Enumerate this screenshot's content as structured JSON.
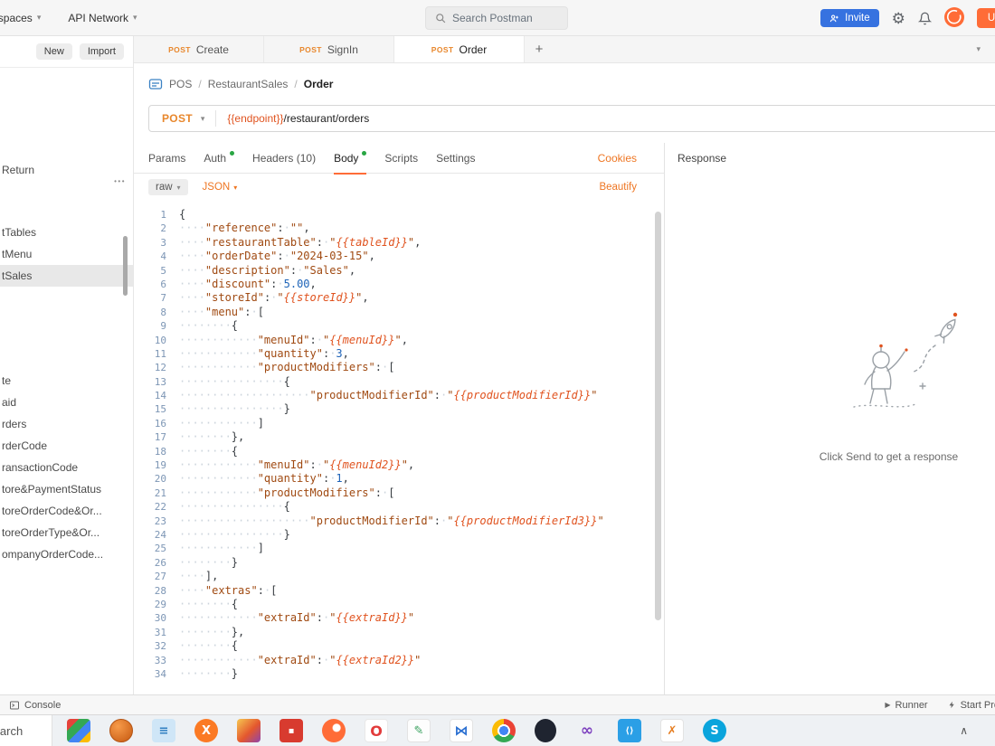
{
  "header": {
    "workspaces": "Workspaces",
    "api_network": "API Network",
    "search_placeholder": "Search Postman",
    "invite": "Invite",
    "upgrade": "Upgrade"
  },
  "icons": {
    "chevron_down": "▾",
    "chevron_up": "∧",
    "more_dots": "•••",
    "gear": "⚙",
    "plus": "+",
    "play": "▶"
  },
  "sidebar": {
    "new_button": "New",
    "import_button": "Import",
    "groups": [
      {
        "items": [
          {
            "label": "Return"
          }
        ]
      },
      {
        "items": [
          {
            "label": "tTables"
          },
          {
            "label": "tMenu"
          },
          {
            "label": "tSales",
            "selected": true
          }
        ]
      },
      {
        "items": [
          {
            "label": "te"
          },
          {
            "label": "aid"
          },
          {
            "label": "rders"
          },
          {
            "label": "rderCode"
          },
          {
            "label": "ransactionCode"
          },
          {
            "label": "tore&PaymentStatus"
          },
          {
            "label": "toreOrderCode&Or..."
          },
          {
            "label": "toreOrderType&Or..."
          },
          {
            "label": "ompanyOrderCode..."
          }
        ]
      }
    ]
  },
  "tabs": {
    "items": [
      {
        "method": "POST",
        "name": "Create"
      },
      {
        "method": "POST",
        "name": "SignIn"
      },
      {
        "method": "POST",
        "name": "Order",
        "active": true
      }
    ]
  },
  "breadcrumb": {
    "part1": "POS",
    "separator": "/",
    "part2": "RestaurantSales",
    "current": "Order"
  },
  "request": {
    "method": "POST",
    "url_variable": "{{endpoint}}",
    "url_path": "/restaurant/orders",
    "tabs": [
      {
        "label": "Params"
      },
      {
        "label": "Auth",
        "dot": true
      },
      {
        "label": "Headers (10)"
      },
      {
        "label": "Body",
        "dot": true,
        "active": true
      },
      {
        "label": "Scripts"
      },
      {
        "label": "Settings"
      }
    ],
    "cookies_link": "Cookies",
    "body_format": "raw",
    "body_language": "JSON",
    "beautify_link": "Beautify"
  },
  "editor": {
    "lines": [
      "{",
      "    \"reference\": \"\",",
      "    \"restaurantTable\": \"{{tableId}}\",",
      "    \"orderDate\": \"2024-03-15\",",
      "    \"description\": \"Sales\",",
      "    \"discount\": 5.00,",
      "    \"storeId\": \"{{storeId}}\",",
      "    \"menu\": [",
      "        {",
      "            \"menuId\": \"{{menuId}}\",",
      "            \"quantity\": 3,",
      "            \"productModifiers\": [",
      "                {",
      "                    \"productModifierId\": \"{{productModifierId}}\"",
      "                }",
      "            ]",
      "        },",
      "        {",
      "            \"menuId\": \"{{menuId2}}\",",
      "            \"quantity\": 1,",
      "            \"productModifiers\": [",
      "                {",
      "                    \"productModifierId\": \"{{productModifierId3}}\"",
      "                }",
      "            ]",
      "        }",
      "    ],",
      "    \"extras\": [",
      "        {",
      "            \"extraId\": \"{{extraId}}\"",
      "        },",
      "        {",
      "            \"extraId\": \"{{extraId2}}\"",
      "        }"
    ]
  },
  "response": {
    "title": "Response",
    "empty_text": "Click Send to get a response"
  },
  "statusbar": {
    "console": "Console",
    "runner": "Runner",
    "start_proxy": "Start Proxy"
  },
  "taskbar": {
    "search_text": "Search",
    "icons": [
      {
        "name": "task-view-icon",
        "cls": "tv"
      },
      {
        "name": "basketball-app-icon",
        "cls": "ball"
      },
      {
        "name": "documents-app-icon",
        "cls": "docs",
        "glyph": "≡"
      },
      {
        "name": "xampp-icon",
        "cls": "xampp",
        "glyph": "X"
      },
      {
        "name": "design-app-icon",
        "cls": "grad"
      },
      {
        "name": "red-app-icon",
        "cls": "redapp",
        "glyph": "▪"
      },
      {
        "name": "postman-app-icon",
        "cls": "postman"
      },
      {
        "name": "opera-icon",
        "cls": "opera",
        "glyph": "O"
      },
      {
        "name": "image-editor-icon",
        "cls": "photo",
        "glyph": "✎"
      },
      {
        "name": "blue-x-app-icon",
        "cls": "bowtie",
        "glyph": "⋈"
      },
      {
        "name": "chrome-icon",
        "cls": "chrome"
      },
      {
        "name": "dark-app-icon",
        "cls": "darkoval"
      },
      {
        "name": "visual-studio-icon",
        "cls": "vs",
        "glyph": "∞"
      },
      {
        "name": "vscode-icon",
        "cls": "vscode",
        "glyph": "⟨⟩"
      },
      {
        "name": "tool-app-icon",
        "cls": "pick",
        "glyph": "✗"
      },
      {
        "name": "skype-icon",
        "cls": "skype",
        "glyph": "S"
      }
    ]
  },
  "colors": {
    "brand_orange": "#ff6c37",
    "link_orange": "#ee7623",
    "method_post": "#e8872c",
    "variable_orange": "#e0531f",
    "key_brown": "#a04a12",
    "number_blue": "#1d63b8",
    "dot_green": "#29a643",
    "invite_blue": "#3672e0"
  }
}
